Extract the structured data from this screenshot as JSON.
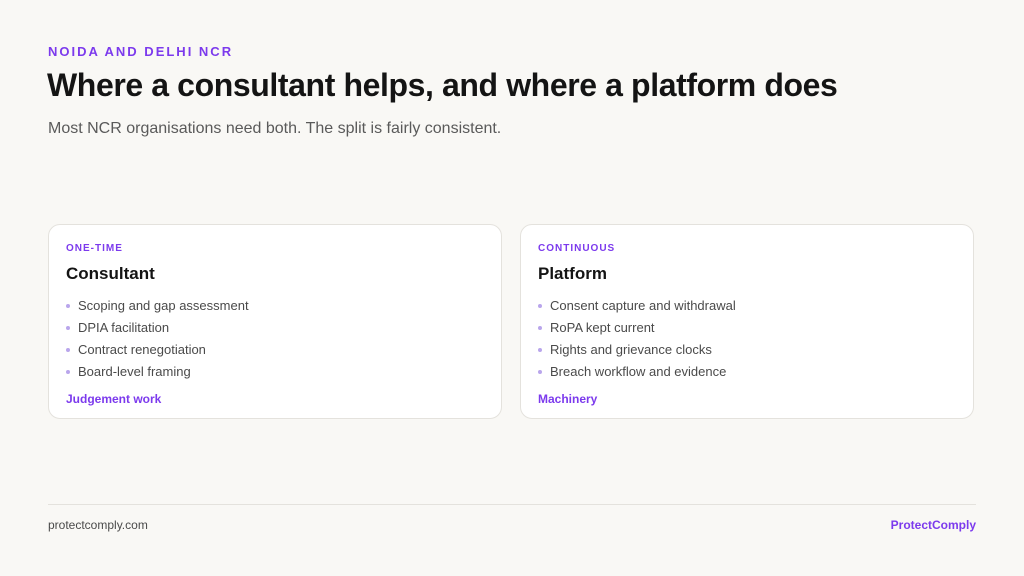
{
  "header": {
    "eyebrow": "NOIDA AND DELHI NCR",
    "title": "Where a consultant helps, and where a platform does",
    "subtitle": "Most NCR organisations need both. The split is fairly consistent."
  },
  "cards": [
    {
      "tag": "ONE-TIME",
      "title": "Consultant",
      "items": [
        "Scoping and gap assessment",
        "DPIA facilitation",
        "Contract renegotiation",
        "Board-level framing"
      ],
      "footer": "Judgement work"
    },
    {
      "tag": "CONTINUOUS",
      "title": "Platform",
      "items": [
        "Consent capture and withdrawal",
        "RoPA kept current",
        "Rights and grievance clocks",
        "Breach workflow and evidence"
      ],
      "footer": "Machinery"
    }
  ],
  "footer": {
    "site": "protectcomply.com",
    "brand": "ProtectComply"
  },
  "colors": {
    "accent": "#7c3aed",
    "background": "#f9f8f5",
    "card": "#ffffff",
    "text": "#141414"
  }
}
